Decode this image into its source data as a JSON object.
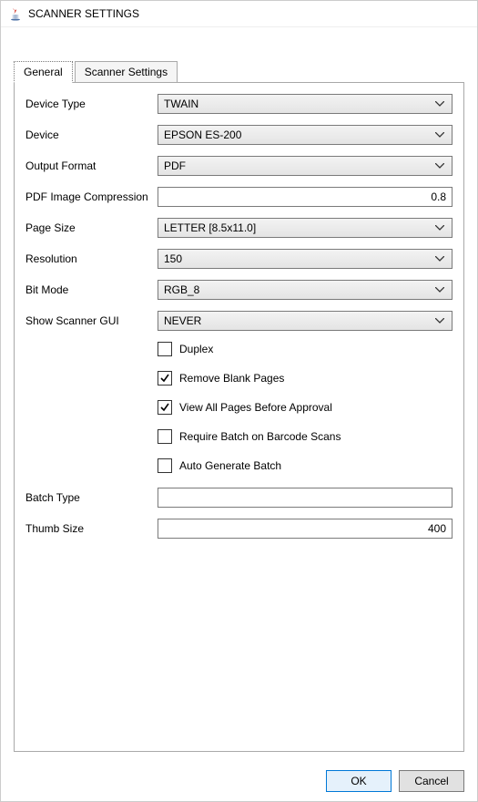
{
  "window": {
    "title": "SCANNER SETTINGS"
  },
  "tabs": {
    "general": "General",
    "scanner_settings": "Scanner Settings"
  },
  "form": {
    "device_type": {
      "label": "Device Type",
      "value": "TWAIN"
    },
    "device": {
      "label": "Device",
      "value": "EPSON ES-200"
    },
    "output_format": {
      "label": "Output Format",
      "value": "PDF"
    },
    "pdf_image_compression": {
      "label": "PDF Image Compression",
      "value": "0.8"
    },
    "page_size": {
      "label": "Page Size",
      "value": "LETTER [8.5x11.0]"
    },
    "resolution": {
      "label": "Resolution",
      "value": "150"
    },
    "bit_mode": {
      "label": "Bit Mode",
      "value": "RGB_8"
    },
    "show_scanner_gui": {
      "label": "Show Scanner GUI",
      "value": "NEVER"
    },
    "batch_type": {
      "label": "Batch Type",
      "value": ""
    },
    "thumb_size": {
      "label": "Thumb Size",
      "value": "400"
    }
  },
  "checkboxes": {
    "duplex": {
      "label": "Duplex",
      "checked": false
    },
    "remove_blank_pages": {
      "label": "Remove Blank Pages",
      "checked": true
    },
    "view_all_pages": {
      "label": "View All Pages Before Approval",
      "checked": true
    },
    "require_batch_barcode": {
      "label": "Require Batch on Barcode Scans",
      "checked": false
    },
    "auto_generate_batch": {
      "label": "Auto Generate Batch",
      "checked": false
    }
  },
  "buttons": {
    "ok": "OK",
    "cancel": "Cancel"
  }
}
